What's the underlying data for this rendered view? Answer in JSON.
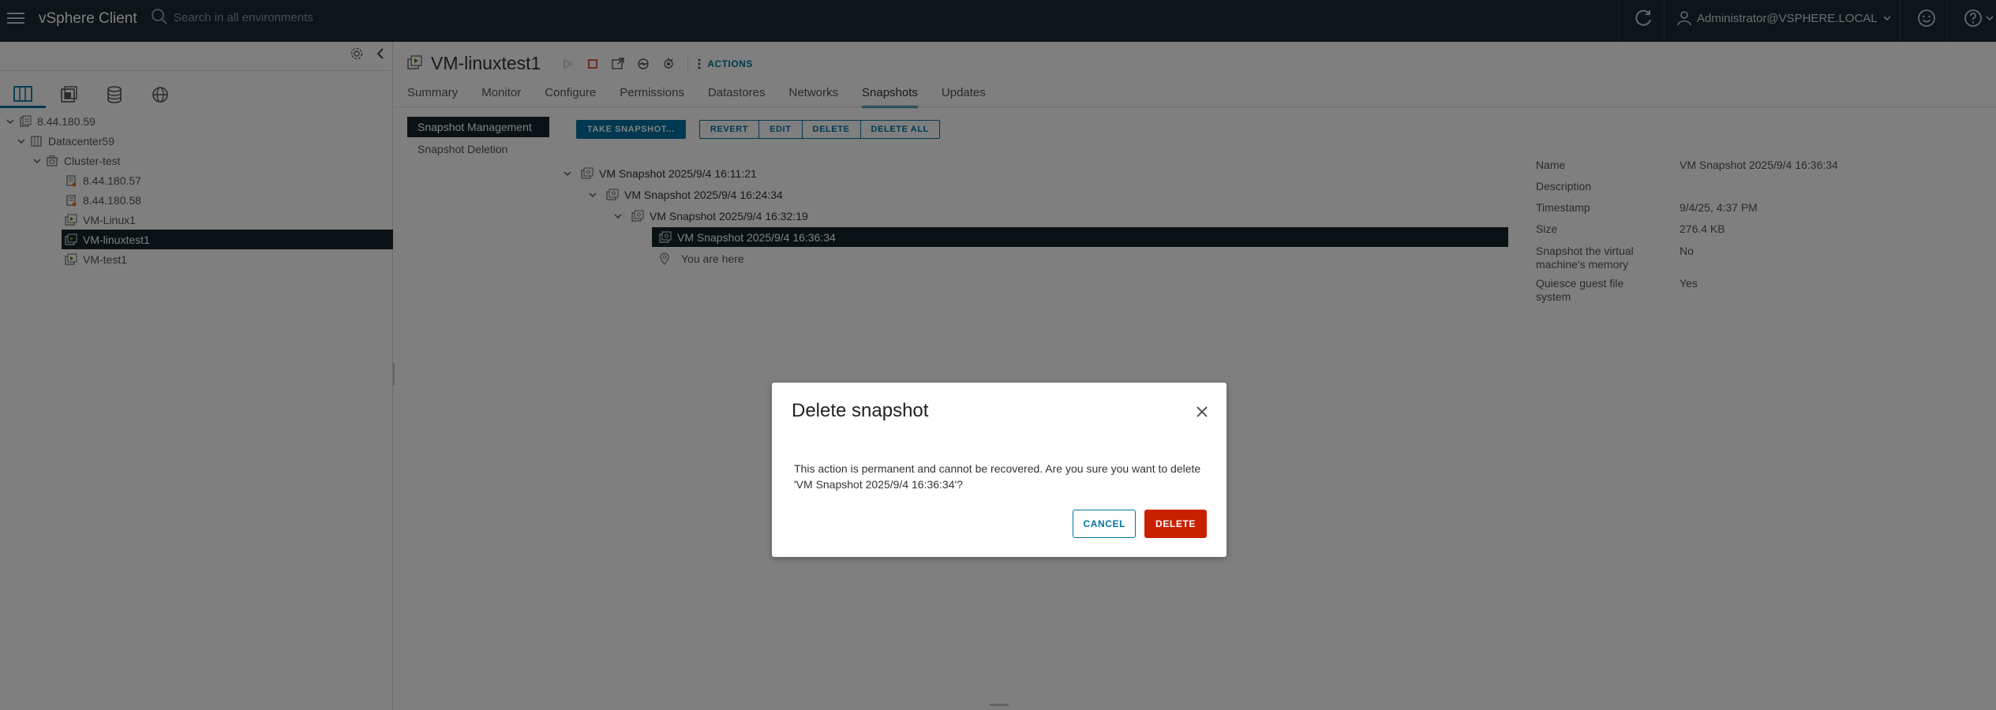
{
  "header": {
    "app_title": "vSphere Client",
    "search_placeholder": "Search in all environments",
    "user": "Administrator@VSPHERE.LOCAL"
  },
  "inventory": {
    "tree": [
      {
        "label": "8.44.180.59",
        "level": 0,
        "expanded": true,
        "type": "vcenter"
      },
      {
        "label": "Datacenter59",
        "level": 1,
        "expanded": true,
        "type": "datacenter"
      },
      {
        "label": "Cluster-test",
        "level": 2,
        "expanded": true,
        "type": "cluster"
      },
      {
        "label": "8.44.180.57",
        "level": 3,
        "type": "host"
      },
      {
        "label": "8.44.180.58",
        "level": 3,
        "type": "host"
      },
      {
        "label": "VM-Linux1",
        "level": 3,
        "type": "vm"
      },
      {
        "label": "VM-linuxtest1",
        "level": 3,
        "type": "vm",
        "selected": true
      },
      {
        "label": "VM-test1",
        "level": 3,
        "type": "vm"
      }
    ]
  },
  "object": {
    "title": "VM-linuxtest1",
    "actions_label": "ACTIONS",
    "tabs": [
      "Summary",
      "Monitor",
      "Configure",
      "Permissions",
      "Datastores",
      "Networks",
      "Snapshots",
      "Updates"
    ],
    "active_tab": "Snapshots"
  },
  "snapshots": {
    "sub_nav": [
      "Snapshot Management",
      "Snapshot Deletion"
    ],
    "take_snapshot": "TAKE SNAPSHOT...",
    "buttons": [
      "REVERT",
      "EDIT",
      "DELETE",
      "DELETE ALL"
    ],
    "tree": [
      {
        "label": "VM Snapshot 2025/9/4 16:11:21",
        "level": 0
      },
      {
        "label": "VM Snapshot 2025/9/4 16:24:34",
        "level": 1
      },
      {
        "label": "VM Snapshot 2025/9/4 16:32:19",
        "level": 2
      },
      {
        "label": "VM Snapshot 2025/9/4 16:36:34",
        "level": 3,
        "selected": true
      },
      {
        "label": "You are here",
        "level": 3,
        "marker": true
      }
    ],
    "details": [
      {
        "label": "Name",
        "value": "VM Snapshot 2025/9/4 16:36:34"
      },
      {
        "label": "Description",
        "value": ""
      },
      {
        "label": "Timestamp",
        "value": "9/4/25, 4:37 PM"
      },
      {
        "label": "Size",
        "value": "276.4 KB"
      },
      {
        "label": "Snapshot the virtual machine's memory",
        "value": "No"
      },
      {
        "label": "Quiesce guest file system",
        "value": "Yes"
      }
    ]
  },
  "dialog": {
    "title": "Delete snapshot",
    "message": "This action is permanent and cannot be recovered. Are you sure you want to delete 'VM Snapshot 2025/9/4 16:36:34'?",
    "cancel_label": "CANCEL",
    "delete_label": "DELETE"
  },
  "colors": {
    "header_bg": "#1b2a32",
    "accent": "#0072a3",
    "selected_bg": "#17242b",
    "danger": "#c92100"
  }
}
